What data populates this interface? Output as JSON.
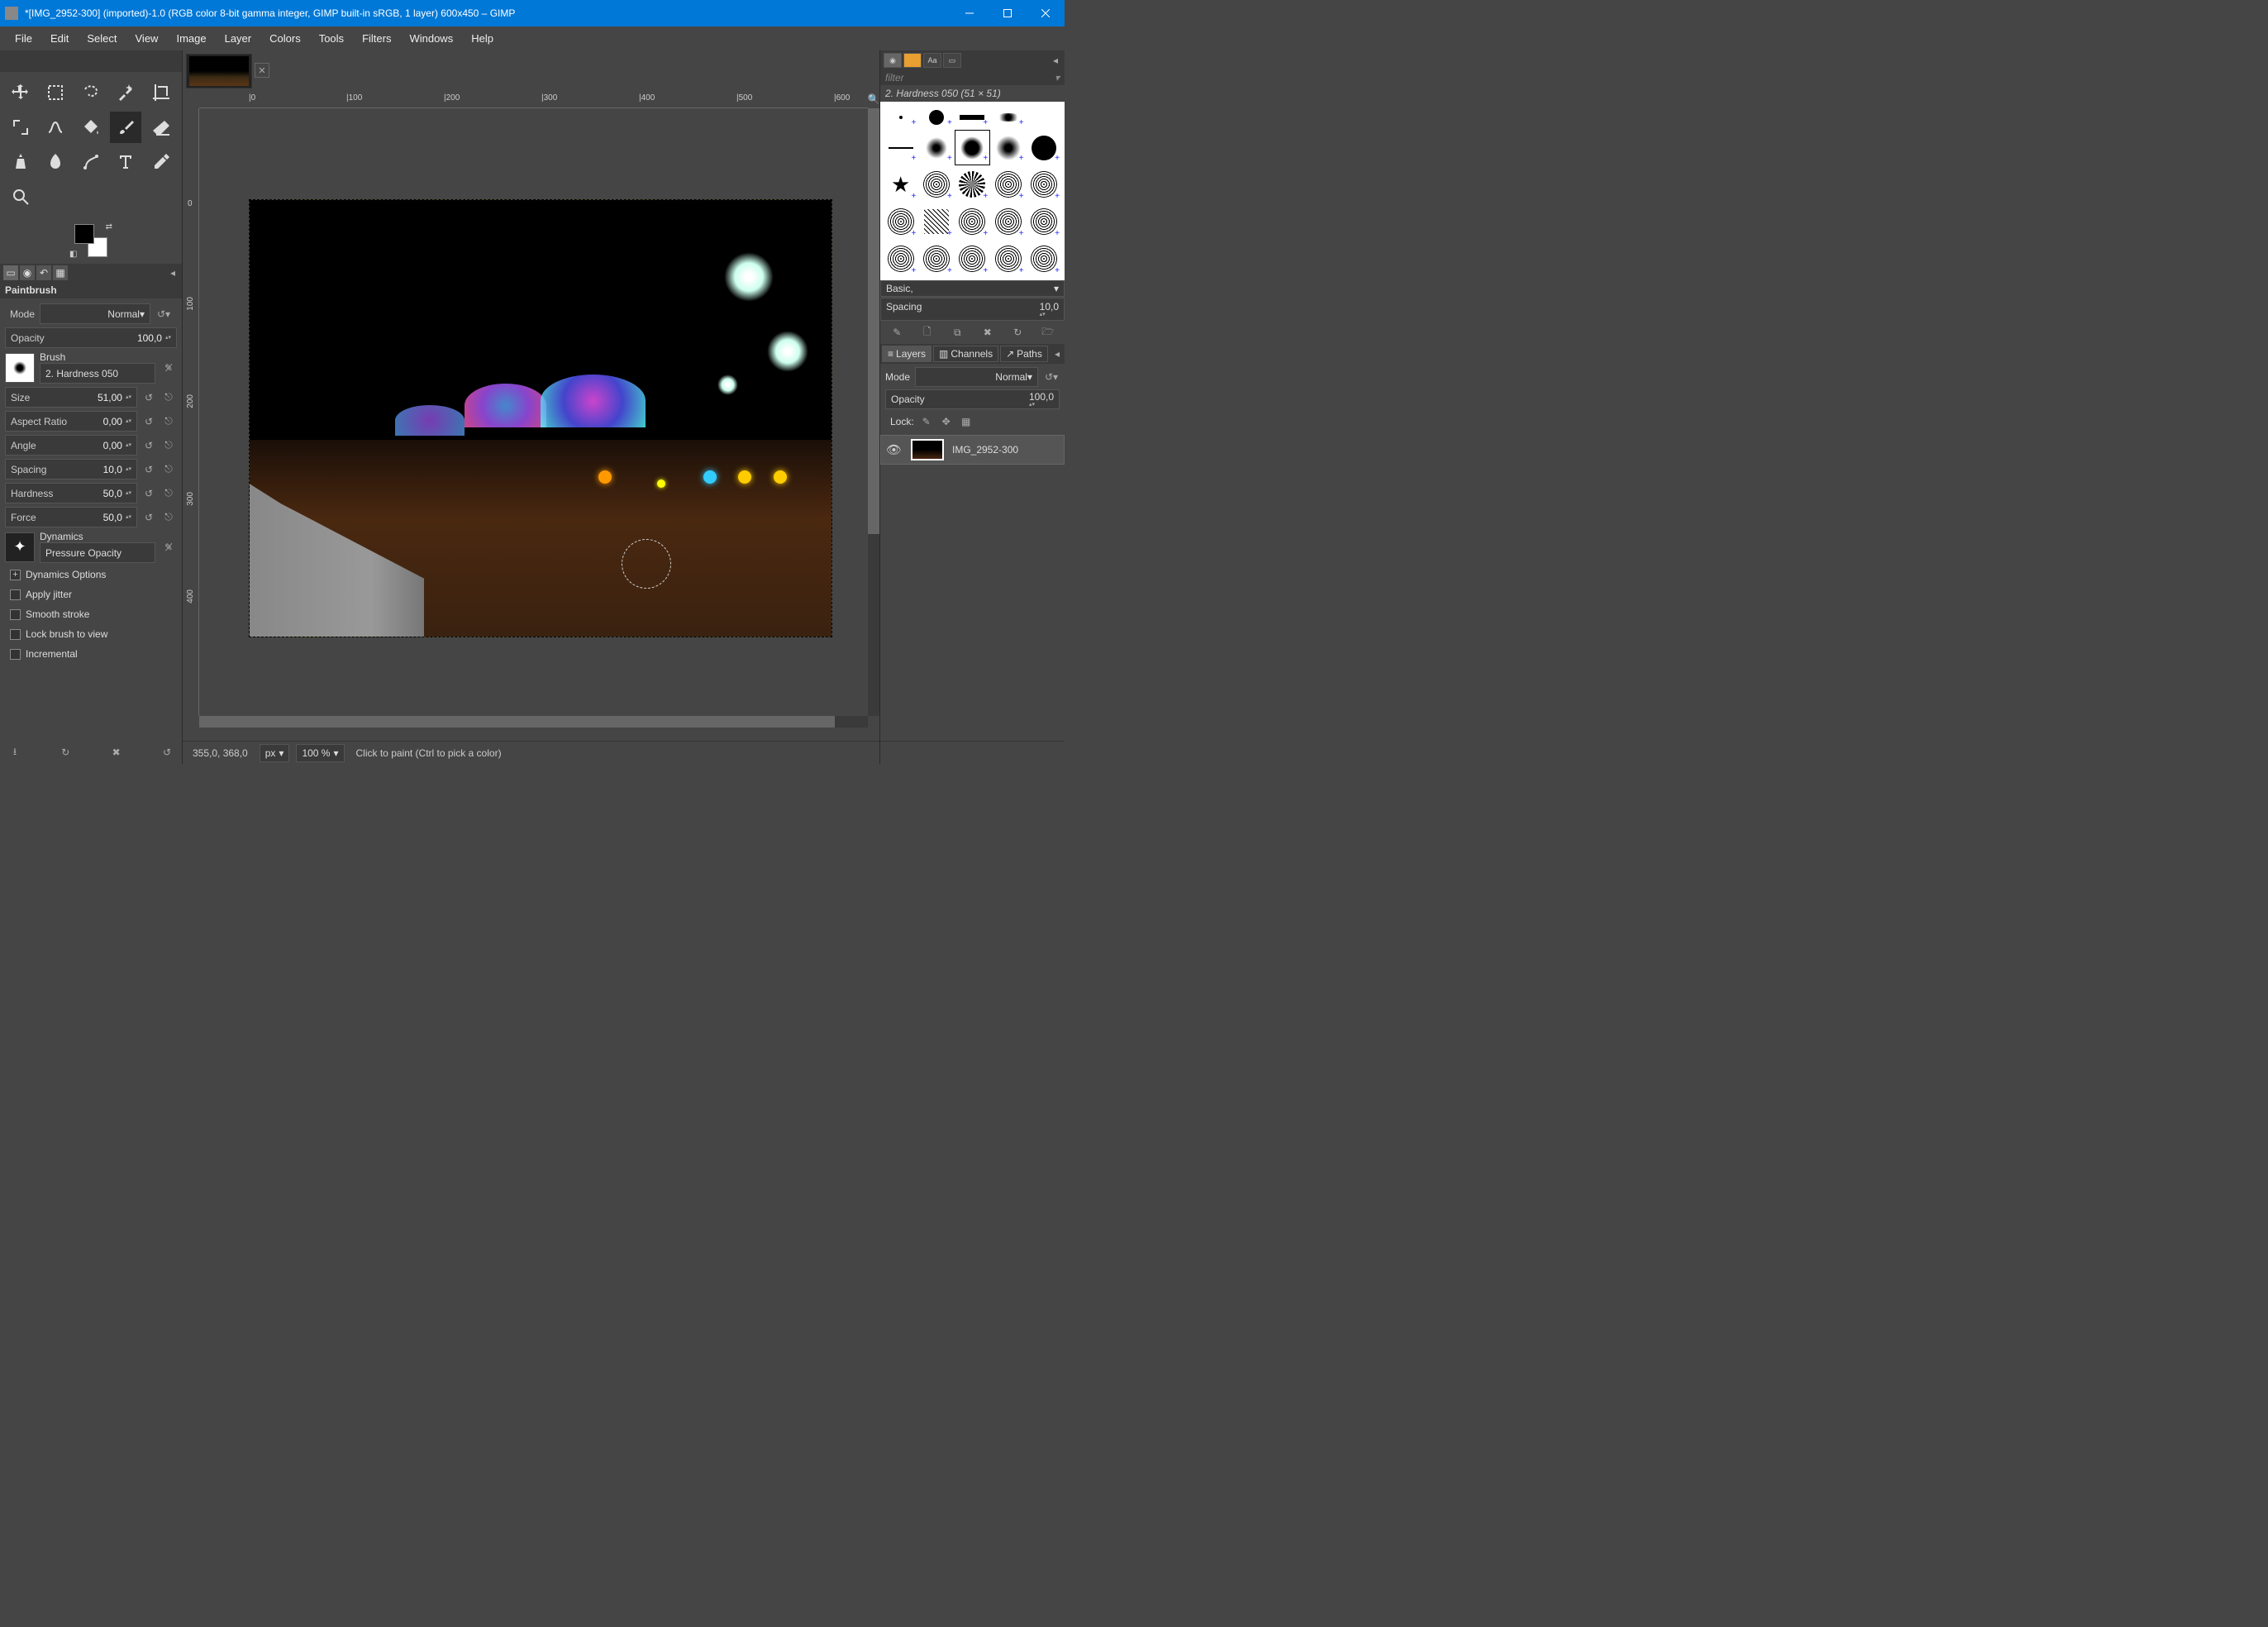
{
  "window": {
    "title": "*[IMG_2952-300] (imported)-1.0 (RGB color 8-bit gamma integer, GIMP built-in sRGB, 1 layer) 600x450 – GIMP"
  },
  "menu": {
    "file": "File",
    "edit": "Edit",
    "select": "Select",
    "view": "View",
    "image": "Image",
    "layer": "Layer",
    "colors": "Colors",
    "tools": "Tools",
    "filters": "Filters",
    "windows": "Windows",
    "help": "Help"
  },
  "toolOptions": {
    "title": "Paintbrush",
    "mode": {
      "label": "Mode",
      "value": "Normal"
    },
    "opacity": {
      "label": "Opacity",
      "value": "100,0"
    },
    "brush": {
      "label": "Brush",
      "value": "2. Hardness 050"
    },
    "size": {
      "label": "Size",
      "value": "51,00"
    },
    "aspect": {
      "label": "Aspect Ratio",
      "value": "0,00"
    },
    "angle": {
      "label": "Angle",
      "value": "0,00"
    },
    "spacing": {
      "label": "Spacing",
      "value": "10,0"
    },
    "hardness": {
      "label": "Hardness",
      "value": "50,0"
    },
    "force": {
      "label": "Force",
      "value": "50,0"
    },
    "dynamics": {
      "label": "Dynamics",
      "value": "Pressure Opacity"
    },
    "dynamicsOptions": "Dynamics Options",
    "applyJitter": "Apply jitter",
    "smoothStroke": "Smooth stroke",
    "lockBrush": "Lock brush to view",
    "incremental": "Incremental"
  },
  "rulerH": [
    "|0",
    "|100",
    "|200",
    "|300",
    "|400",
    "|500",
    "|600"
  ],
  "rulerV": [
    "0",
    "100",
    "200",
    "300",
    "400"
  ],
  "status": {
    "coords": "355,0, 368,0",
    "unit": "px",
    "zoom": "100 %",
    "hint": "Click to paint (Ctrl to pick a color)"
  },
  "brushes": {
    "filterPlaceholder": "filter",
    "title": "2. Hardness 050 (51 × 51)",
    "preset": "Basic,",
    "spacing": {
      "label": "Spacing",
      "value": "10,0"
    }
  },
  "layers": {
    "layersTab": "Layers",
    "channelsTab": "Channels",
    "pathsTab": "Paths",
    "mode": {
      "label": "Mode",
      "value": "Normal"
    },
    "opacity": {
      "label": "Opacity",
      "value": "100,0"
    },
    "lock": "Lock:",
    "layer1": "IMG_2952-300"
  }
}
